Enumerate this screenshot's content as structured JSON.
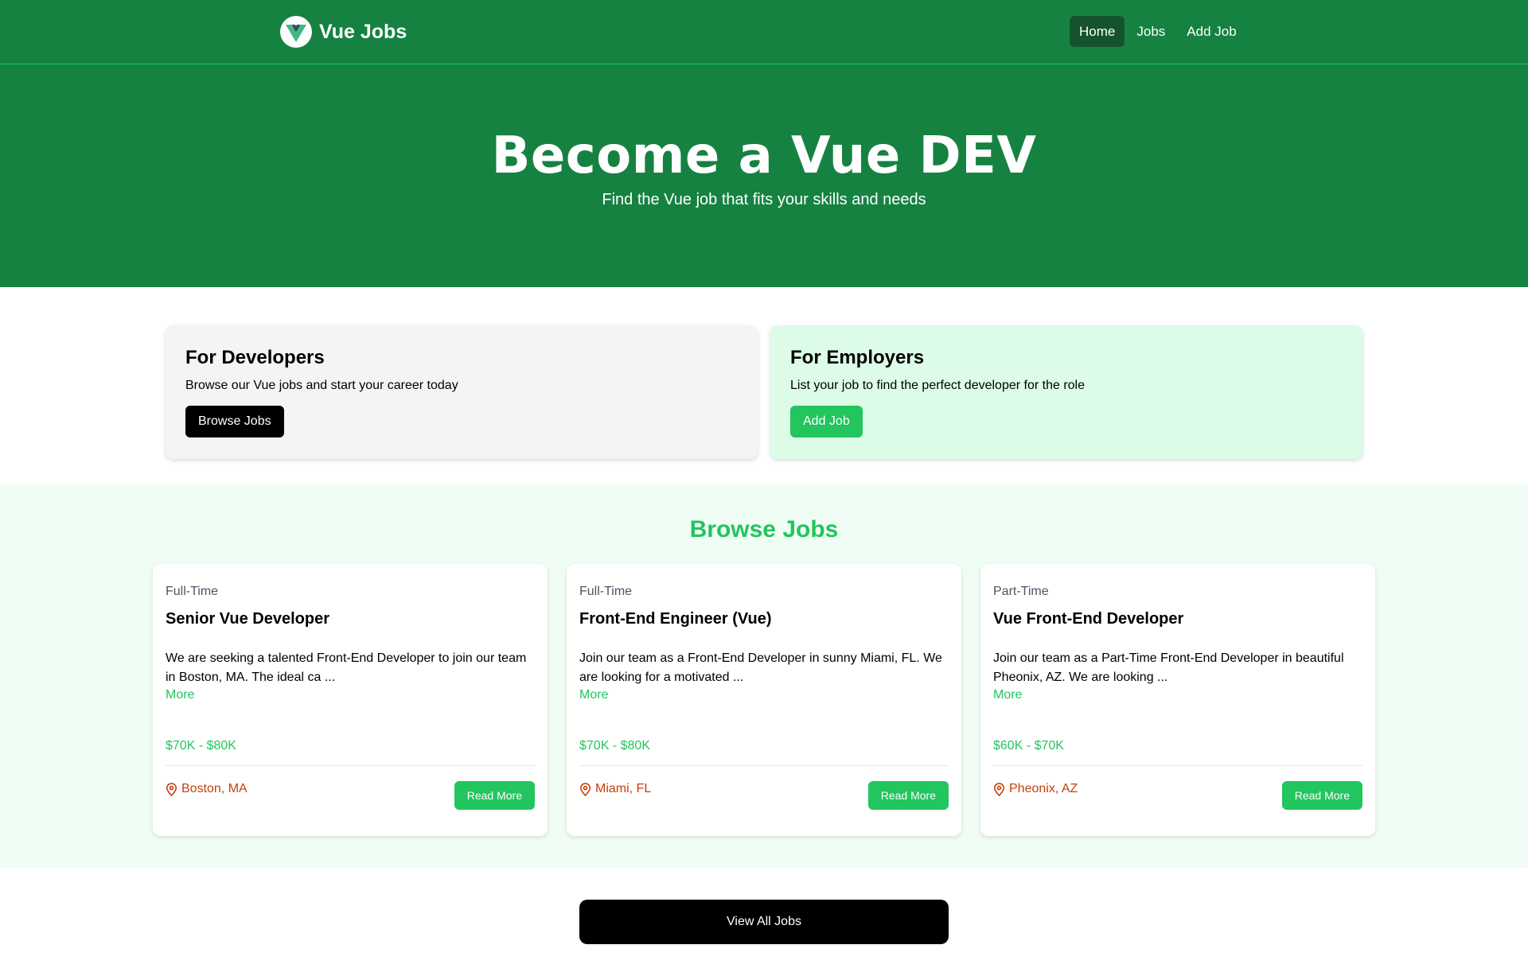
{
  "nav": {
    "brand": "Vue Jobs",
    "links": [
      "Home",
      "Jobs",
      "Add Job"
    ]
  },
  "hero": {
    "title": "Become a Vue DEV",
    "subtitle": "Find the Vue job that fits your skills and needs"
  },
  "cards": {
    "developers": {
      "title": "For Developers",
      "text": "Browse our Vue jobs and start your career today",
      "button": "Browse Jobs"
    },
    "employers": {
      "title": "For Employers",
      "text": "List your job to find the perfect developer for the role",
      "button": "Add Job"
    }
  },
  "browse": {
    "title": "Browse Jobs",
    "jobs": [
      {
        "type": "Full-Time",
        "title": "Senior Vue Developer",
        "description": "We are seeking a talented Front-End Developer to join our team in Boston, MA. The ideal ca ...",
        "more": "More",
        "salary": "$70K - $80K",
        "location": "Boston, MA",
        "button": "Read More"
      },
      {
        "type": "Full-Time",
        "title": "Front-End Engineer (Vue)",
        "description": "Join our team as a Front-End Developer in sunny Miami, FL. We are looking for a motivated ...",
        "more": "More",
        "salary": "$70K - $80K",
        "location": "Miami, FL",
        "button": "Read More"
      },
      {
        "type": "Part-Time",
        "title": "Vue Front-End Developer",
        "description": "Join our team as a Part-Time Front-End Developer in beautiful Pheonix, AZ. We are looking ...",
        "more": "More",
        "salary": "$60K - $70K",
        "location": "Pheonix, AZ",
        "button": "Read More"
      }
    ]
  },
  "view_all": "View All Jobs",
  "colors": {
    "nav_bg": "#168241",
    "accent": "#22c55e",
    "location": "#c2410c"
  }
}
